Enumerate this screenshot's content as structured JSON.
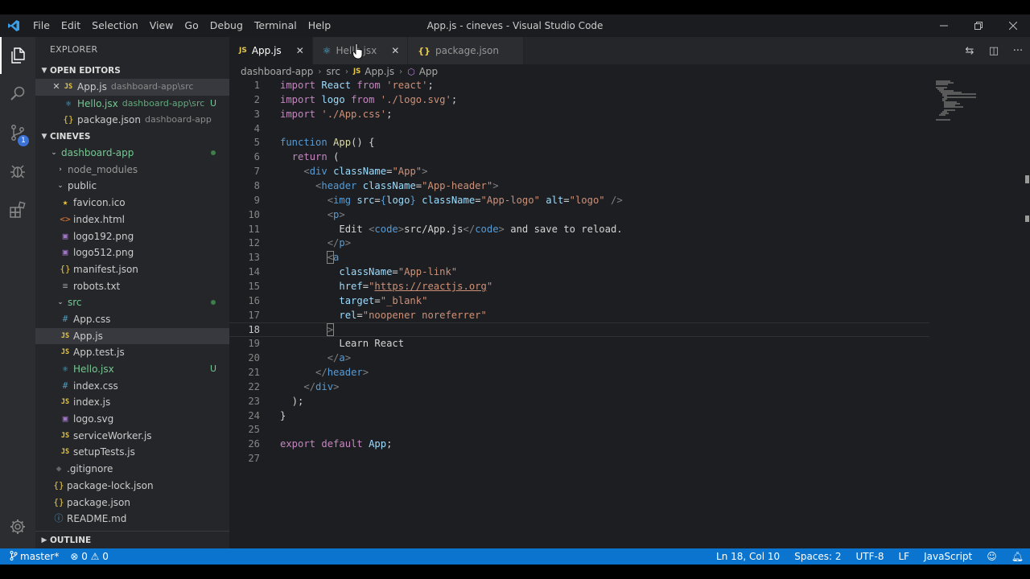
{
  "window": {
    "title": "App.js - cineves - Visual Studio Code",
    "menu": [
      "File",
      "Edit",
      "Selection",
      "View",
      "Go",
      "Debug",
      "Terminal",
      "Help"
    ],
    "controls": [
      "minimize-icon",
      "restore-icon",
      "close-icon"
    ]
  },
  "activity": {
    "icons": [
      "files-icon",
      "search-icon",
      "source-control-icon",
      "debug-icon",
      "extensions-icon",
      "gear-icon"
    ],
    "scm_badge": "1"
  },
  "sidebar": {
    "title": "EXPLORER",
    "open_editors": {
      "header": "OPEN EDITORS",
      "items": [
        {
          "name": "App.js",
          "desc": "dashboard-app\\src",
          "icon": "JS"
        },
        {
          "name": "Hello.jsx",
          "desc": "dashboard-app\\src",
          "badge": "U"
        },
        {
          "name": "package.json",
          "desc": "dashboard-app",
          "icon": "{}"
        }
      ]
    },
    "project": {
      "header": "CINEVES",
      "tree": [
        {
          "name": "dashboard-app",
          "icon": "⌄"
        },
        {
          "name": "node_modules",
          "icon": "›"
        },
        {
          "name": "public",
          "icon": "⌄"
        },
        {
          "name": "favicon.ico",
          "icon": "★"
        },
        {
          "name": "index.html",
          "icon": "<>"
        },
        {
          "name": "logo192.png",
          "icon": "▣"
        },
        {
          "name": "logo512.png",
          "icon": "▣"
        },
        {
          "name": "manifest.json",
          "icon": "{}"
        },
        {
          "name": "robots.txt",
          "icon": "≡"
        },
        {
          "name": "src",
          "icon": "⌄"
        },
        {
          "name": "App.css",
          "icon": "#"
        },
        {
          "name": "App.js",
          "icon": "JS"
        },
        {
          "name": "App.test.js",
          "icon": "JS"
        },
        {
          "name": "Hello.jsx",
          "icon": "⚛",
          "badge": "U"
        },
        {
          "name": "index.css",
          "icon": "#"
        },
        {
          "name": "index.js",
          "icon": "JS"
        },
        {
          "name": "logo.svg",
          "icon": "▣"
        },
        {
          "name": "serviceWorker.js",
          "icon": "JS"
        },
        {
          "name": "setupTests.js",
          "icon": "JS"
        },
        {
          "name": ".gitignore",
          "icon": "◆"
        },
        {
          "name": "package-lock.json",
          "icon": "{}"
        },
        {
          "name": "package.json",
          "icon": "{}"
        },
        {
          "name": "README.md",
          "icon": "ⓘ"
        }
      ]
    },
    "outline_header": "OUTLINE"
  },
  "tabs": [
    {
      "label": "App.js",
      "icon": "JS"
    },
    {
      "label": "Hello.jsx",
      "icon": "⚛"
    },
    {
      "label": "package.json",
      "icon": "{}"
    }
  ],
  "breadcrumb": [
    "dashboard-app",
    "src",
    "App.js",
    "App"
  ],
  "editor": {
    "line_numbers": [
      "1",
      "2",
      "3",
      "4",
      "5",
      "6",
      "7",
      "8",
      "9",
      "10",
      "11",
      "12",
      "13",
      "14",
      "15",
      "16",
      "17",
      "18",
      "19",
      "20",
      "21",
      "22",
      "23",
      "24",
      "25",
      "26",
      "27"
    ]
  },
  "status": {
    "branch": "master*",
    "problems": "⊗ 0 ⚠ 0",
    "position": "Ln 18, Col 10",
    "spaces": "Spaces: 2",
    "encoding": "UTF-8",
    "eol": "LF",
    "language": "JavaScript"
  },
  "colors": {
    "statusbar": "#0a74cf",
    "editor_bg": "#1d1e21",
    "sidebar_bg": "#25262a",
    "untracked": "#73c991"
  }
}
